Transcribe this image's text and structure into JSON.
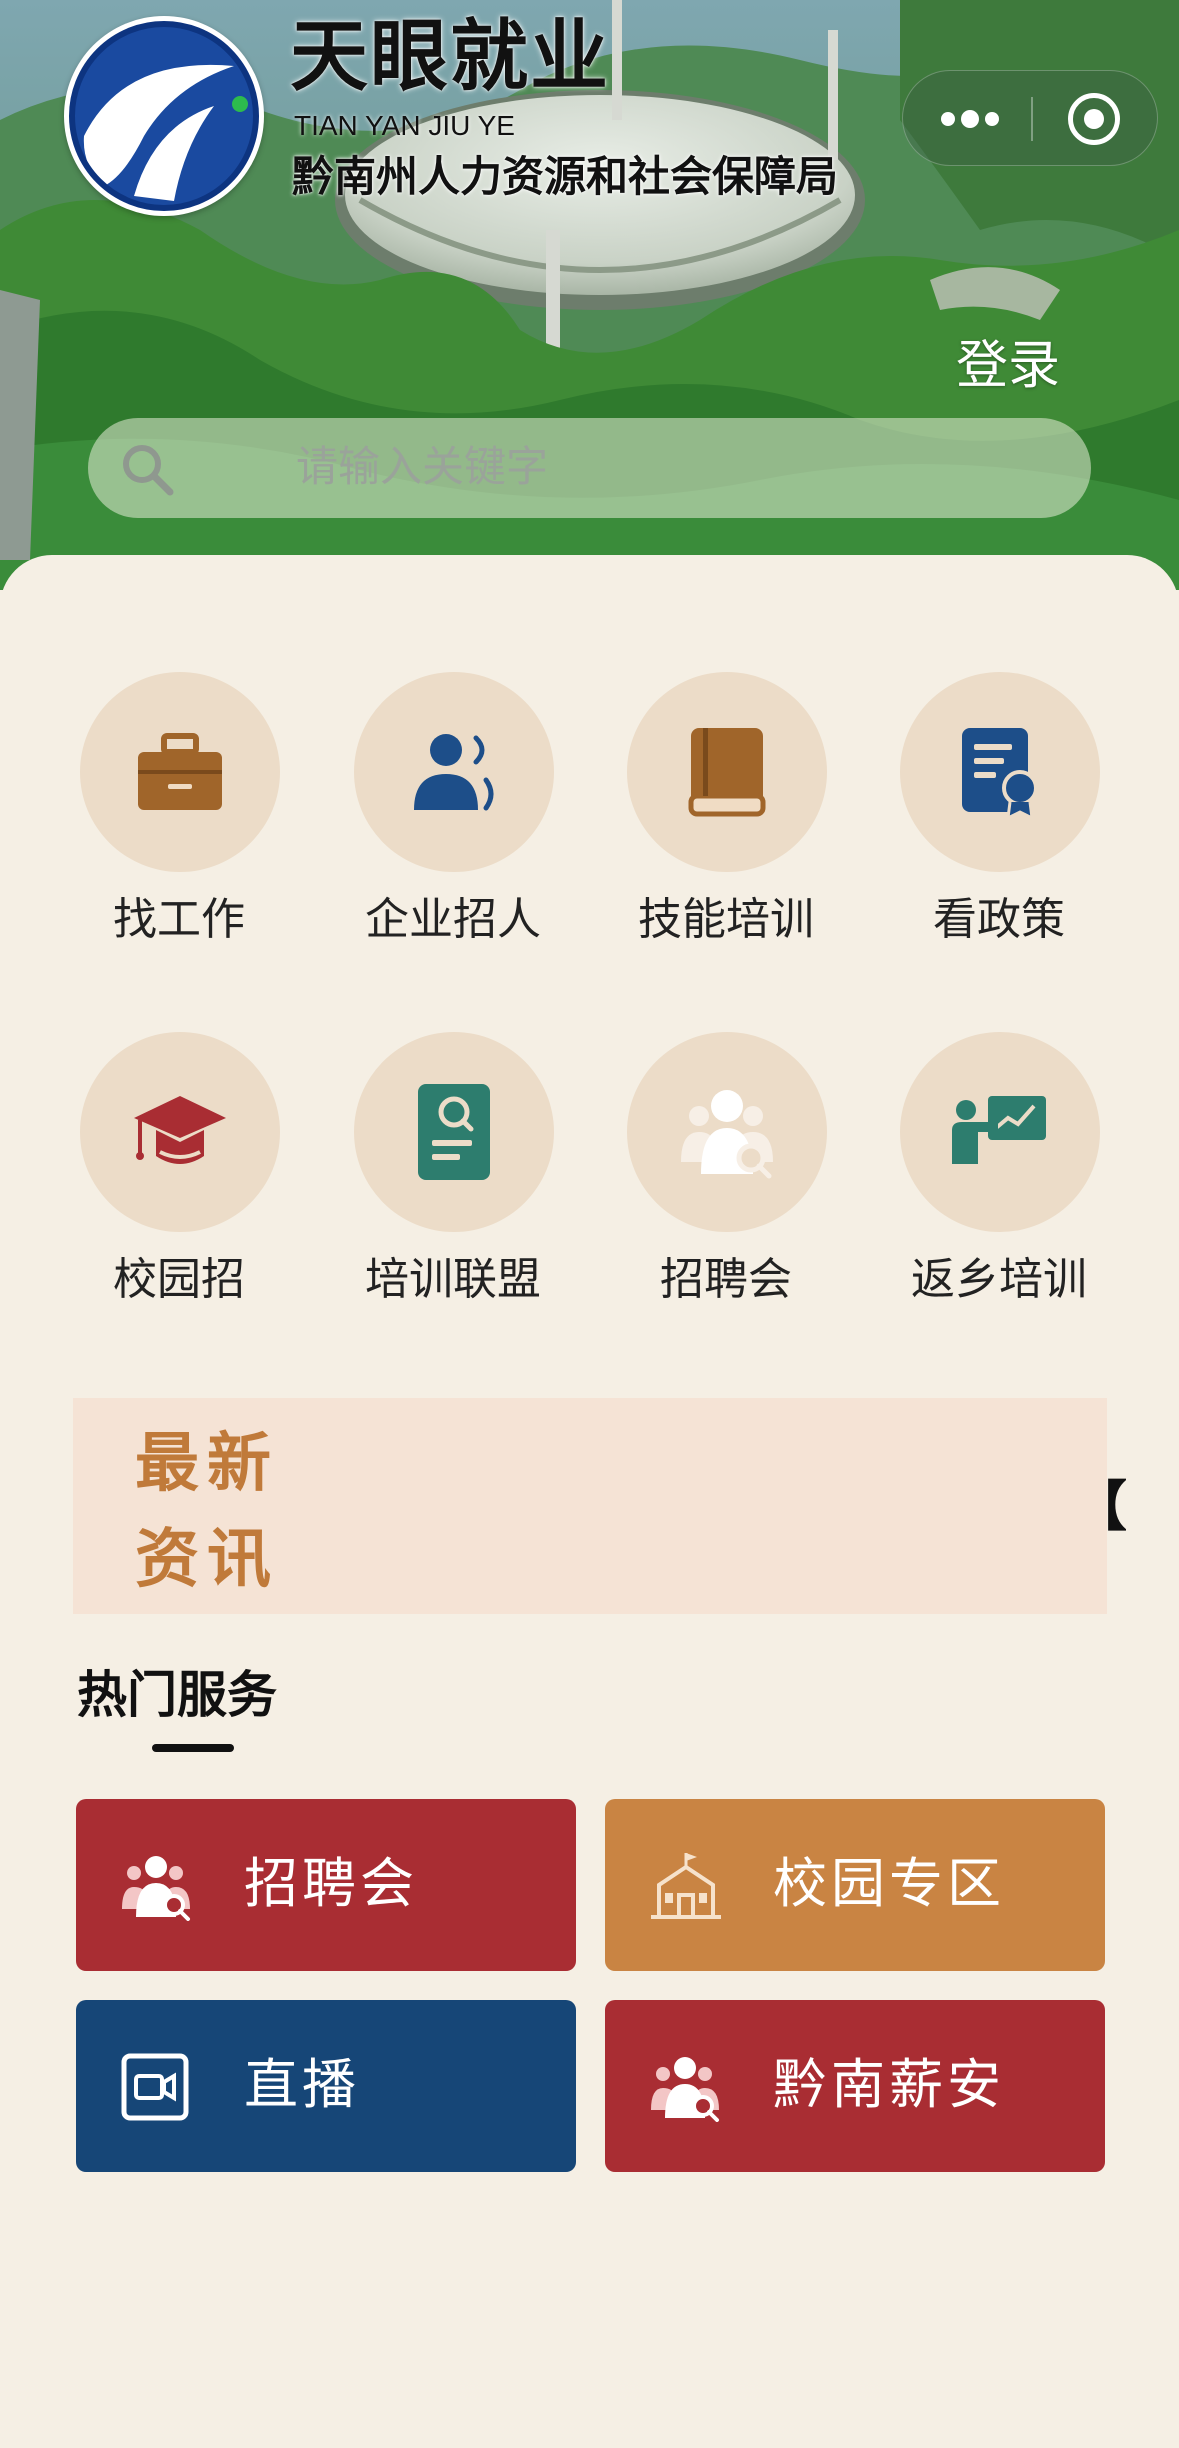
{
  "app": {
    "title": "天眼就业",
    "pinyin": "TIAN YAN JIU YE",
    "organization": "黔南州人力资源和社会保障局"
  },
  "header": {
    "login_label": "登录",
    "search_placeholder": "请输入关键字"
  },
  "menu": [
    {
      "label": "找工作",
      "icon": "briefcase-icon",
      "color": "#a0652a"
    },
    {
      "label": "企业招人",
      "icon": "person-speaking-icon",
      "color": "#1d4e89"
    },
    {
      "label": "技能培训",
      "icon": "book-icon",
      "color": "#a0652a"
    },
    {
      "label": "看政策",
      "icon": "certificate-icon",
      "color": "#1d4e89"
    },
    {
      "label": "校园招",
      "icon": "graduation-cap-icon",
      "color": "#a92d33"
    },
    {
      "label": "培训联盟",
      "icon": "search-document-icon",
      "color": "#2d7d6e"
    },
    {
      "label": "招聘会",
      "icon": "people-search-icon",
      "color": "#f6ede4"
    },
    {
      "label": "返乡培训",
      "icon": "presentation-icon",
      "color": "#2d7d6e"
    }
  ],
  "news": {
    "line1": "最新",
    "line2": "资讯",
    "marquee": "【"
  },
  "hot_services": {
    "title": "热门服务",
    "items": [
      {
        "label": "招聘会",
        "icon": "people-search-icon",
        "color": "#a92d33"
      },
      {
        "label": "校园专区",
        "icon": "school-building-icon",
        "color": "#c98443"
      },
      {
        "label": "直播",
        "icon": "video-camera-icon",
        "color": "#164677"
      },
      {
        "label": "黔南薪安",
        "icon": "people-search-icon",
        "color": "#a92d33"
      }
    ]
  }
}
